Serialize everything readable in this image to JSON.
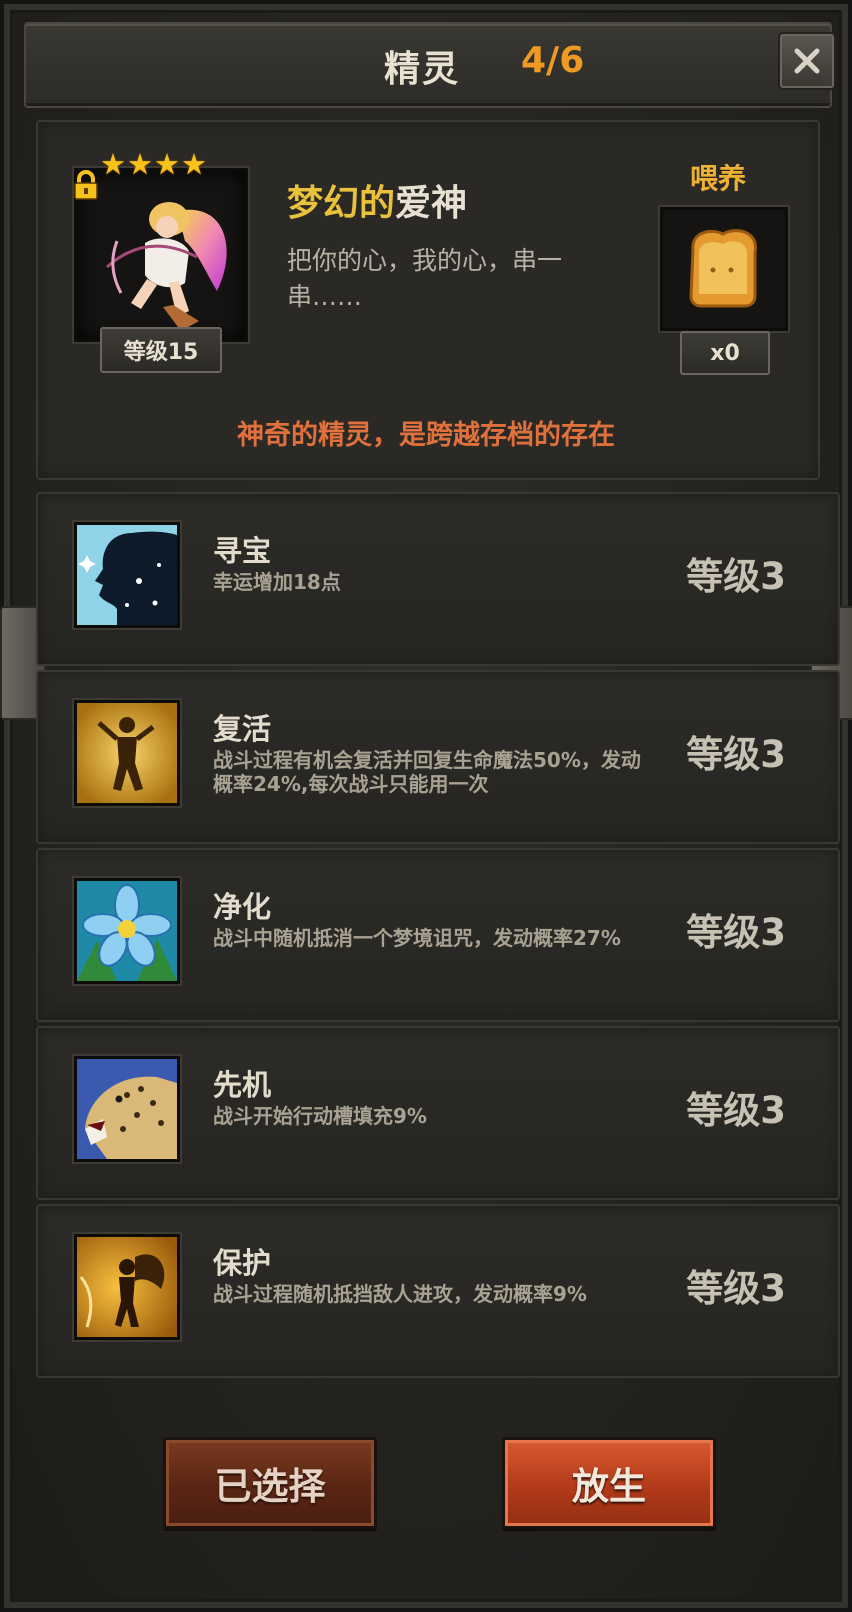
{
  "header": {
    "title": "精灵",
    "count": "4/6"
  },
  "sprite": {
    "stars": 4,
    "level_tag": "等级15",
    "name_part1": "梦幻的",
    "name_part2": "爱神",
    "description": "把你的心，我的心，串一串……",
    "tagline": "神奇的精灵，是跨越存档的存在"
  },
  "feed": {
    "label": "喂养",
    "count": "x0"
  },
  "skills": [
    {
      "name": "寻宝",
      "desc": "幸运增加18点",
      "level": "等级3",
      "icon": "silhouette-stars-icon"
    },
    {
      "name": "复活",
      "desc": "战斗过程有机会复活并回复生命魔法50%，发动概率24%,每次战斗只能用一次",
      "level": "等级3",
      "icon": "resurrect-figure-icon"
    },
    {
      "name": "净化",
      "desc": "战斗中随机抵消一个梦境诅咒，发动概率27%",
      "level": "等级3",
      "icon": "blue-flower-icon"
    },
    {
      "name": "先机",
      "desc": "战斗开始行动槽填充9%",
      "level": "等级3",
      "icon": "leopard-icon"
    },
    {
      "name": "保护",
      "desc": "战斗过程随机抵挡敌人进攻，发动概率9%",
      "level": "等级3",
      "icon": "fairy-shield-icon"
    }
  ],
  "buttons": {
    "selected": "已选择",
    "release": "放生"
  },
  "colors": {
    "accent_orange": "#f09a26",
    "gold": "#f6c21b",
    "tagline": "#e0703c",
    "button_red": "#b23a1a"
  }
}
